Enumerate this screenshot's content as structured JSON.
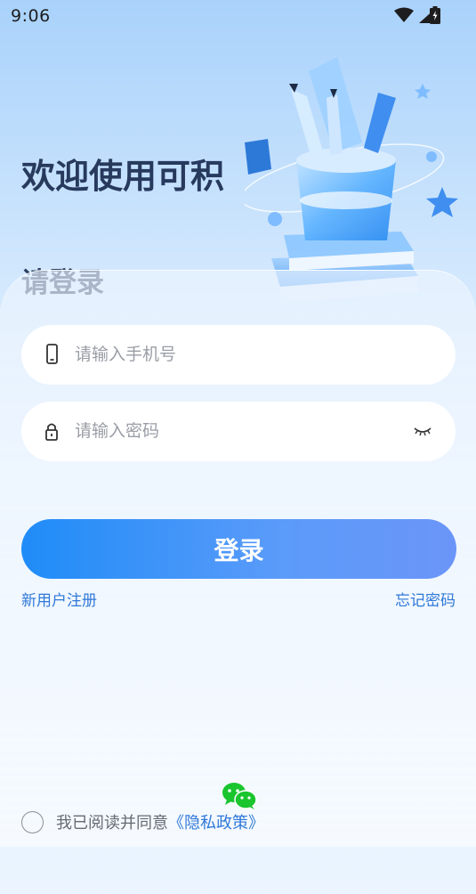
{
  "status_bar": {
    "time": "9:06"
  },
  "welcome": {
    "title": "欢迎使用可积",
    "subtitle": "请登录"
  },
  "form": {
    "phone_placeholder": "请输入手机号",
    "password_placeholder": "请输入密码",
    "login_label": "登录"
  },
  "links": {
    "register": "新用户注册",
    "forgot": "忘记密码"
  },
  "agreement": {
    "text": "我已阅读并同意",
    "policy": "《隐私政策》"
  },
  "colors": {
    "accent": "#1f8cf8",
    "link": "#2f78d8",
    "title": "#273a5e",
    "wechat": "#1ac52e"
  }
}
